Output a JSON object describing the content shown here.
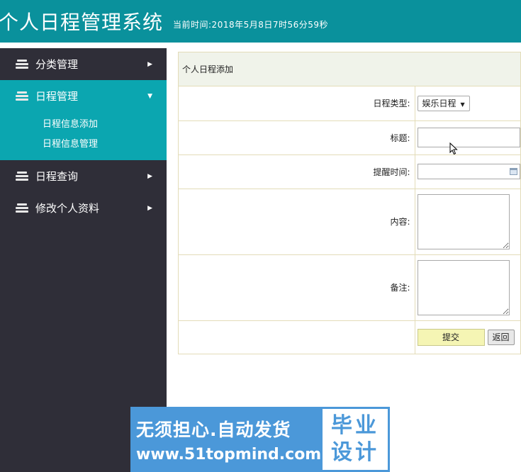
{
  "header": {
    "title": "个人日程管理系统",
    "current_time": "当前时间:2018年5月8日7时56分59秒"
  },
  "sidebar": {
    "items": [
      {
        "label": "分类管理",
        "arrow": "▶"
      },
      {
        "label": "日程管理",
        "arrow": "▼",
        "sub": [
          "日程信息添加",
          "日程信息管理"
        ]
      },
      {
        "label": "日程查询",
        "arrow": "▶"
      },
      {
        "label": "修改个人资料",
        "arrow": "▶"
      }
    ]
  },
  "form": {
    "title": "个人日程添加",
    "fields": {
      "type_label": "日程类型:",
      "type_value": "娱乐日程",
      "title_label": "标题:",
      "title_value": "",
      "remind_label": "提醒时间:",
      "remind_value": "",
      "content_label": "内容:",
      "content_value": "",
      "note_label": "备注:",
      "note_value": ""
    },
    "submit_label": "提交",
    "back_label": "返回"
  },
  "watermark": {
    "line1": "无须担心.自动发货",
    "line2": "www.51topmind.com",
    "badge_1": "毕业",
    "badge_2": "设计"
  },
  "colors": {
    "header_bg": "#0a919c",
    "sidebar_bg": "#2f2e38",
    "sidebar_active": "#0ba6b0",
    "panel_border": "#e3dcb8",
    "watermark_blue": "#4b98d9"
  }
}
